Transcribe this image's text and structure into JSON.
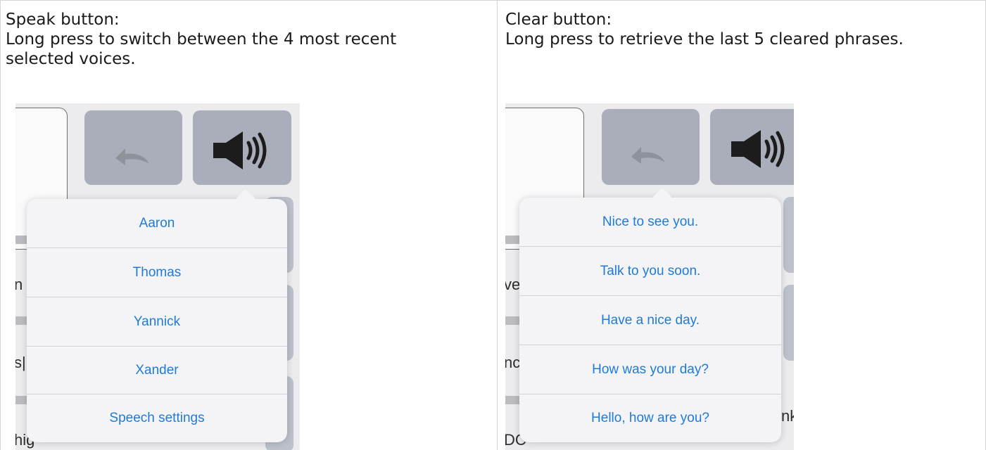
{
  "left_panel": {
    "title": "Speak button:",
    "description": "Long press to switch between the 4 most recent selected voices.",
    "voices": [
      "Aaron",
      "Thomas",
      "Yannick",
      "Xander"
    ],
    "settings_label": "Speech settings",
    "side_fragments": [
      "n",
      "s|",
      "hig"
    ]
  },
  "right_panel": {
    "title": "Clear button:",
    "description": "Long press to retrieve the last 5 cleared phrases.",
    "phrases": [
      "Nice to see you.",
      "Talk to you soon.",
      "Have a nice day.",
      "How was your day?",
      "Hello, how are you?"
    ],
    "side_fragments": [
      "ve",
      "nc",
      "DC",
      "nk"
    ]
  },
  "icons": {
    "undo": "undo-arrow-icon",
    "speaker": "speaker-icon"
  },
  "colors": {
    "menu_text": "#1e7bd8",
    "key": "#a9aeba",
    "popover_bg": "#f4f4f6"
  }
}
